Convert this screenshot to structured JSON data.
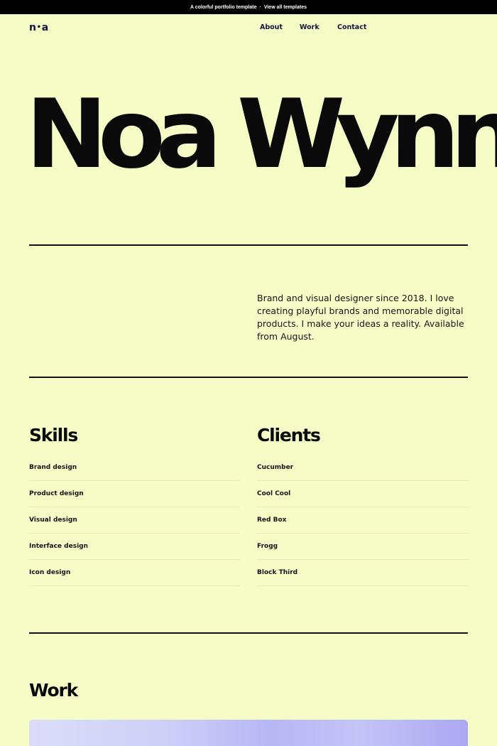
{
  "banner": {
    "text": "A colorful portfolio template",
    "separator": "·",
    "link": "View all templates"
  },
  "header": {
    "logo_left": "n",
    "logo_dot": "•",
    "logo_right": "a",
    "nav": [
      "About",
      "Work",
      "Contact"
    ]
  },
  "hero": {
    "name": "Noa Wynn"
  },
  "intro": {
    "text": "Brand and visual designer since 2018. I love creating playful brands and memorable digital products. I make your ideas a reality. Available from August."
  },
  "skills": {
    "title": "Skills",
    "items": [
      "Brand design",
      "Product design",
      "Visual design",
      "Interface design",
      "Icon design"
    ]
  },
  "clients": {
    "title": "Clients",
    "items": [
      "Cucumber",
      "Cool Cool",
      "Red Box",
      "Frogg",
      "Block Third"
    ]
  },
  "work": {
    "title": "Work"
  },
  "colors": {
    "background": "#f5fcc6",
    "text": "#0d0d0d",
    "nav": "#13123a",
    "banner": "#000000"
  }
}
